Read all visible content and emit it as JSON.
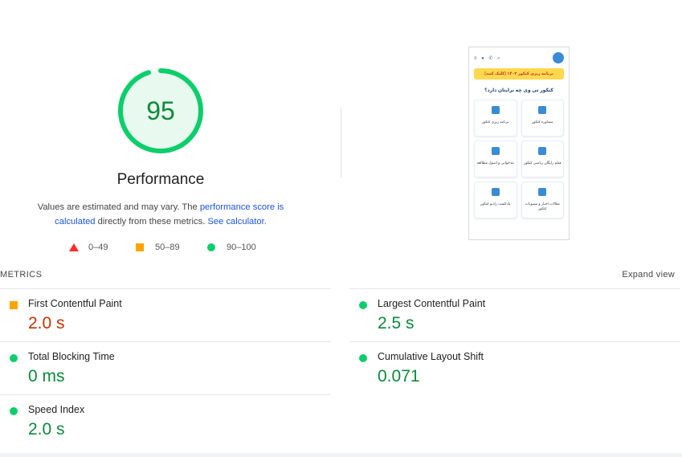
{
  "score": {
    "value": "95",
    "fraction": 0.95,
    "title": "Performance"
  },
  "description": {
    "part1": "Values are estimated and may vary. The ",
    "link1": "performance score is calculated",
    "part2": " directly from these metrics. ",
    "link2": "See calculator."
  },
  "legend": [
    {
      "range": "0–49",
      "shape": "triangle",
      "color": "#ff2b2b"
    },
    {
      "range": "50–89",
      "shape": "square",
      "color": "#ffa400"
    },
    {
      "range": "90–100",
      "shape": "circle",
      "color": "#0cce6b"
    }
  ],
  "thumbnail": {
    "banner": "برنامه ریزی کنکور ۱۴۰۳ (کلیک کنید)",
    "question": "کنکور تی وی چه برایتان دارد؟",
    "cards": [
      "مشاوره کنکور",
      "برنامه ریزی کنکور",
      "فیلم رایگان ریاضی کنکور",
      "تندخوانی و اصول مطالعه",
      "مقالات اخبار و مصوبات کنکور",
      "پادکست رادیو کنکور"
    ]
  },
  "metrics": {
    "header": "METRICS",
    "expand": "Expand view",
    "items": [
      {
        "name": "First Contentful Paint",
        "value": "2.0 s",
        "status": "average"
      },
      {
        "name": "Largest Contentful Paint",
        "value": "2.5 s",
        "status": "pass"
      },
      {
        "name": "Total Blocking Time",
        "value": "0 ms",
        "status": "pass"
      },
      {
        "name": "Cumulative Layout Shift",
        "value": "0.071",
        "status": "pass"
      },
      {
        "name": "Speed Index",
        "value": "2.0 s",
        "status": "pass"
      }
    ]
  },
  "colors": {
    "pass": "#0cce6b",
    "average": "#ffa400",
    "fail": "#ff2b2b",
    "link": "#1a55d8"
  }
}
